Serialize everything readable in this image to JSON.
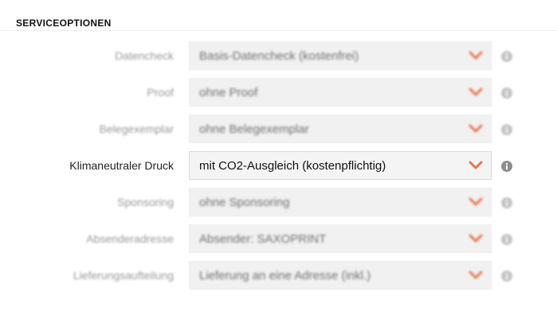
{
  "section": {
    "title": "SERVICEOPTIONEN"
  },
  "colors": {
    "accent": "#e8744a",
    "info": "#c4c4c4",
    "info_sharp": "#8e8e8e"
  },
  "options": [
    {
      "label": "Datencheck",
      "value": "Basis-Datencheck (kostenfrei)",
      "icon": "chevron-down-icon"
    },
    {
      "label": "Proof",
      "value": "ohne Proof",
      "icon": "chevron-down-icon"
    },
    {
      "label": "Belegexemplar",
      "value": "ohne Belegexemplar",
      "icon": "chevron-down-icon"
    },
    {
      "label": "Klimaneutraler Druck",
      "value": "mit CO2-Ausgleich (kostenpflichtig)",
      "icon": "chevron-down-icon"
    },
    {
      "label": "Sponsoring",
      "value": "ohne Sponsoring",
      "icon": "chevron-down-icon"
    },
    {
      "label": "Absenderadresse",
      "value": "Absender: SAXOPRINT",
      "icon": "chevron-down-icon"
    },
    {
      "label": "Lieferungsaufteilung",
      "value": "Lieferung an eine Adresse (inkl.)",
      "icon": "chevron-down-icon"
    }
  ]
}
